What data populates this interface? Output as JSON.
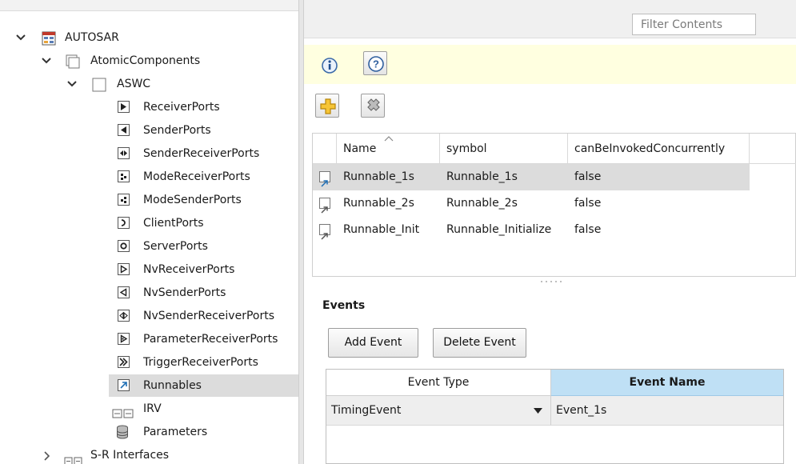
{
  "tree": {
    "root": {
      "label": "AUTOSAR"
    },
    "atomic": {
      "label": "AtomicComponents"
    },
    "component": {
      "label": "ASWC"
    },
    "items": [
      {
        "label": "ReceiverPorts",
        "icon": "receiver-port-icon"
      },
      {
        "label": "SenderPorts",
        "icon": "sender-port-icon"
      },
      {
        "label": "SenderReceiverPorts",
        "icon": "sender-receiver-port-icon"
      },
      {
        "label": "ModeReceiverPorts",
        "icon": "mode-receiver-port-icon"
      },
      {
        "label": "ModeSenderPorts",
        "icon": "mode-sender-port-icon"
      },
      {
        "label": "ClientPorts",
        "icon": "client-port-icon"
      },
      {
        "label": "ServerPorts",
        "icon": "server-port-icon"
      },
      {
        "label": "NvReceiverPorts",
        "icon": "nv-receiver-port-icon"
      },
      {
        "label": "NvSenderPorts",
        "icon": "nv-sender-port-icon"
      },
      {
        "label": "NvSenderReceiverPorts",
        "icon": "nv-sender-receiver-port-icon"
      },
      {
        "label": "ParameterReceiverPorts",
        "icon": "parameter-receiver-port-icon"
      },
      {
        "label": "TriggerReceiverPorts",
        "icon": "trigger-receiver-port-icon"
      },
      {
        "label": "Runnables",
        "icon": "runnable-icon"
      },
      {
        "label": "IRV",
        "icon": "irv-icon"
      },
      {
        "label": "Parameters",
        "icon": "database-icon"
      }
    ],
    "sr_interfaces": {
      "label": "S-R Interfaces"
    }
  },
  "filter": {
    "placeholder": "Filter Contents"
  },
  "toolbar": {
    "info_icon": "info-icon",
    "help_icon": "help-icon",
    "add_icon": "add-icon",
    "delete_icon": "delete-icon"
  },
  "runnables_table": {
    "columns": [
      "Name",
      "symbol",
      "canBeInvokedConcurrently"
    ],
    "rows": [
      {
        "name": "Runnable_1s",
        "symbol": "Runnable_1s",
        "concurrent": "false"
      },
      {
        "name": "Runnable_2s",
        "symbol": "Runnable_2s",
        "concurrent": "false"
      },
      {
        "name": "Runnable_Init",
        "symbol": "Runnable_Initialize",
        "concurrent": "false"
      }
    ]
  },
  "events": {
    "title": "Events",
    "add_label": "Add Event",
    "delete_label": "Delete Event",
    "columns": [
      "Event Type",
      "Event Name"
    ],
    "rows": [
      {
        "type": "TimingEvent",
        "name": "Event_1s"
      }
    ]
  },
  "colors": {
    "selection": "#dcdcdc",
    "info_bar": "#ffffe0",
    "header_highlight": "#bfe0f5"
  }
}
